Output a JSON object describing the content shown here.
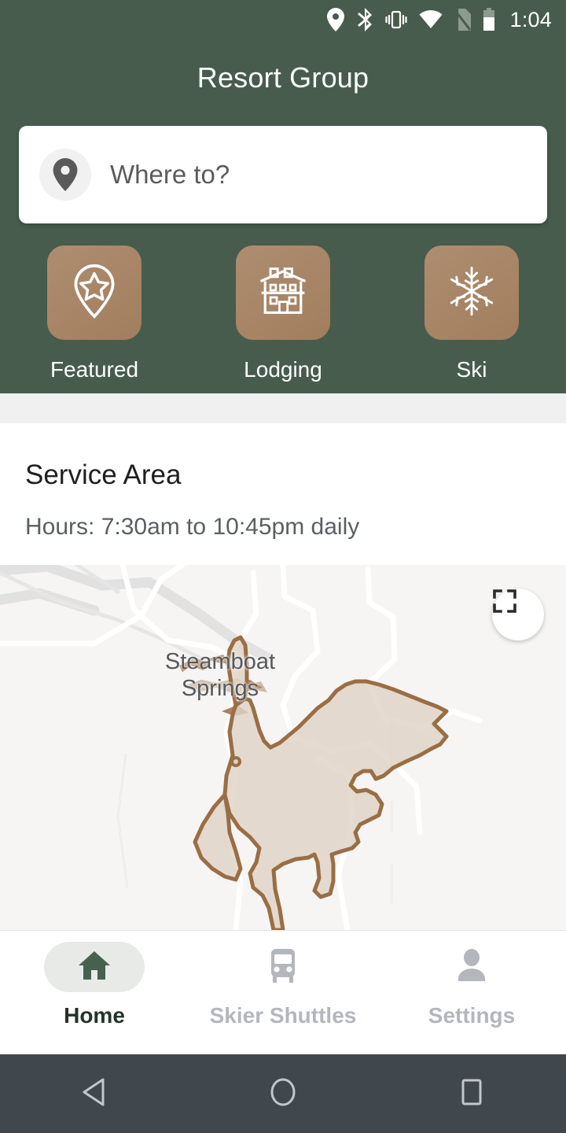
{
  "status_bar": {
    "time": "1:04",
    "icons": [
      "location-icon",
      "bluetooth-icon",
      "vibrate-icon",
      "wifi-icon",
      "no-sim-icon",
      "battery-icon"
    ]
  },
  "header": {
    "title": "Resort Group",
    "background_color": "#475C4C"
  },
  "search": {
    "placeholder": "Where to?",
    "icon": "location-pin-icon"
  },
  "categories": [
    {
      "label": "Featured",
      "icon": "pin-star-icon"
    },
    {
      "label": "Lodging",
      "icon": "lodge-building-icon"
    },
    {
      "label": "Ski",
      "icon": "snowflake-icon"
    }
  ],
  "category_tile_color": "#A88567",
  "service_area": {
    "title": "Service Area",
    "hours": "Hours: 7:30am to 10:45pm daily"
  },
  "map": {
    "label": "Steamboat Springs",
    "label_line1": "Steamboat",
    "label_line2": "Springs",
    "fullscreen_icon": "fullscreen-expand-icon",
    "polygon_fill": "#DFD3C6",
    "polygon_stroke": "#9A6E44",
    "background_color": "#F6F5F4"
  },
  "bottom_nav": [
    {
      "label": "Home",
      "icon": "home-icon",
      "active": true
    },
    {
      "label": "Skier Shuttles",
      "icon": "bus-icon",
      "active": false
    },
    {
      "label": "Settings",
      "icon": "person-icon",
      "active": false
    }
  ],
  "android_nav": [
    {
      "name": "back-button",
      "icon": "triangle-back-icon"
    },
    {
      "name": "home-button",
      "icon": "circle-home-icon"
    },
    {
      "name": "recents-button",
      "icon": "square-recents-icon"
    }
  ]
}
